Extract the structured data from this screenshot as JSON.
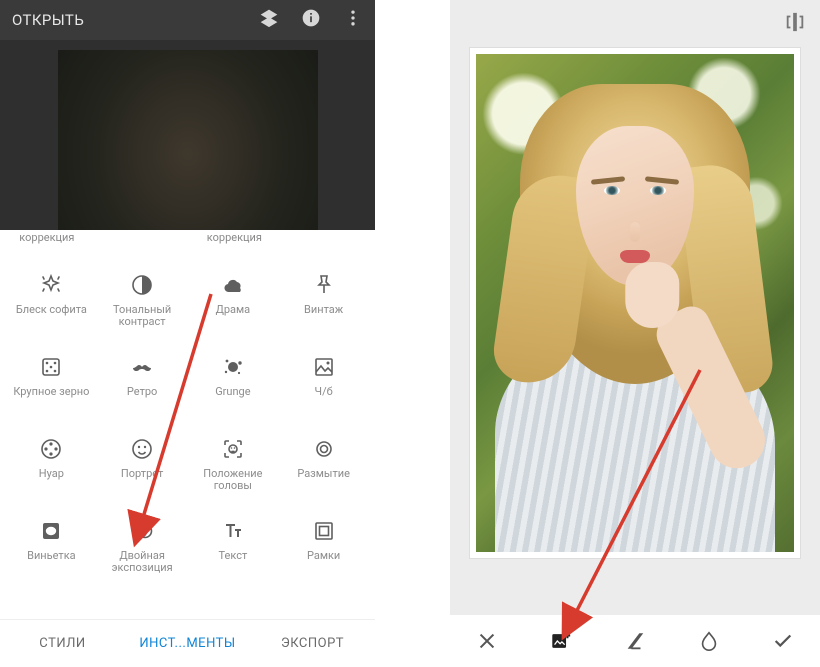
{
  "left": {
    "open_label": "ОТКРЫТЬ",
    "peek": {
      "a": "коррекция",
      "b": "коррекция"
    },
    "tools": {
      "drama": "Драма",
      "vintage": "Винтаж",
      "tonal": "Тональный контраст",
      "glamour": "Блеск софита",
      "grainy": "Крупное зерно",
      "retro": "Ретро",
      "grunge": "Grunge",
      "bw": "Ч/б",
      "noir": "Нуар",
      "portrait": "Портрет",
      "headpose": "Положение головы",
      "blur": "Размытие",
      "vignette": "Виньетка",
      "double": "Двойная экспозиция",
      "text": "Текст",
      "frames": "Рамки"
    },
    "tabs": {
      "styles": "СТИЛИ",
      "tools": "ИНСТ...МЕНТЫ",
      "export": "ЭКСПОРТ"
    }
  }
}
